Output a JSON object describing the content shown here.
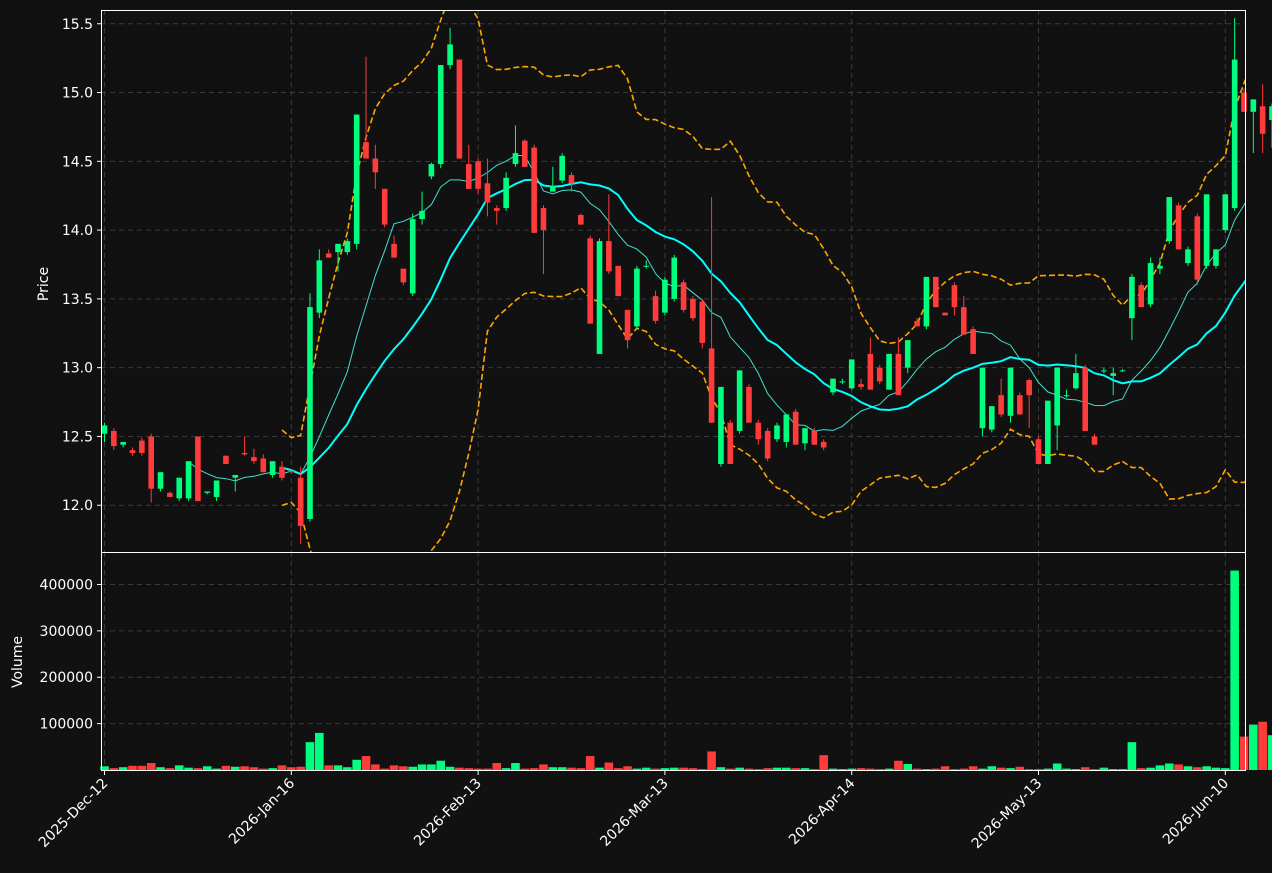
{
  "colors": {
    "background": "#111111",
    "up": "#00ff7f",
    "down": "#ff3b3b",
    "bollinger": "#ffa500",
    "ma_fast": "#40e0d0",
    "ma_slow": "#00ffff",
    "grid": "#3a3a3a",
    "axis": "#ffffff"
  },
  "chart_data": {
    "type": "candlestick",
    "panels": [
      "price",
      "volume"
    ],
    "title": "",
    "price_ylabel": "Price",
    "volume_ylabel": "Volume",
    "price_ylim": [
      11.66,
      15.6
    ],
    "price_yticks": [
      12.0,
      12.5,
      13.0,
      13.5,
      14.0,
      14.5,
      15.0,
      15.5
    ],
    "volume_ylim": [
      0,
      470000
    ],
    "volume_yticks": [
      100000,
      200000,
      300000,
      400000
    ],
    "x_tick_labels": [
      "2025-Dec-12",
      "2026-Jan-16",
      "2026-Feb-13",
      "2026-Mar-13",
      "2026-Apr-14",
      "2026-May-13",
      "2026-Jun-10"
    ],
    "x_tick_indices": [
      0,
      20,
      40,
      60,
      80,
      100,
      120
    ],
    "grid": true,
    "candles": [
      [
        12.52,
        12.6,
        12.46,
        12.58
      ],
      [
        12.54,
        12.56,
        12.4,
        12.43
      ],
      [
        12.44,
        12.46,
        12.42,
        12.46
      ],
      [
        12.4,
        12.42,
        12.36,
        12.38
      ],
      [
        12.47,
        12.49,
        12.36,
        12.38
      ],
      [
        12.5,
        12.52,
        12.02,
        12.12
      ],
      [
        12.12,
        12.24,
        12.1,
        12.24
      ],
      [
        12.09,
        12.1,
        12.06,
        12.06
      ],
      [
        12.05,
        12.2,
        12.03,
        12.2
      ],
      [
        12.05,
        12.32,
        12.03,
        12.32
      ],
      [
        12.5,
        12.5,
        12.03,
        12.03
      ],
      [
        12.09,
        12.1,
        12.08,
        12.1
      ],
      [
        12.06,
        12.18,
        12.03,
        12.18
      ],
      [
        12.36,
        12.36,
        12.3,
        12.3
      ],
      [
        12.2,
        12.22,
        12.1,
        12.22
      ],
      [
        12.38,
        12.5,
        12.36,
        12.37
      ],
      [
        12.35,
        12.41,
        12.3,
        12.32
      ],
      [
        12.34,
        12.37,
        12.24,
        12.24
      ],
      [
        12.22,
        12.32,
        12.2,
        12.32
      ],
      [
        12.28,
        12.32,
        12.18,
        12.2
      ],
      [
        12.25,
        12.26,
        12.23,
        12.24
      ],
      [
        12.2,
        12.28,
        11.72,
        11.85
      ],
      [
        11.9,
        13.54,
        11.88,
        13.44
      ],
      [
        13.4,
        13.86,
        13.36,
        13.78
      ],
      [
        13.83,
        13.86,
        13.8,
        13.8
      ],
      [
        13.84,
        13.9,
        13.7,
        13.9
      ],
      [
        13.84,
        13.94,
        13.82,
        13.92
      ],
      [
        13.9,
        14.84,
        13.86,
        14.84
      ],
      [
        14.64,
        15.26,
        14.52,
        14.52
      ],
      [
        14.52,
        14.62,
        14.3,
        14.42
      ],
      [
        14.3,
        14.3,
        14.02,
        14.04
      ],
      [
        13.9,
        13.96,
        13.8,
        13.8
      ],
      [
        13.72,
        13.72,
        13.6,
        13.62
      ],
      [
        13.54,
        14.12,
        13.52,
        14.08
      ],
      [
        14.08,
        14.28,
        14.04,
        14.14
      ],
      [
        14.39,
        14.49,
        14.37,
        14.48
      ],
      [
        14.48,
        15.2,
        14.45,
        15.2
      ],
      [
        15.2,
        15.47,
        15.17,
        15.35
      ],
      [
        15.24,
        15.24,
        14.52,
        14.52
      ],
      [
        14.48,
        14.62,
        14.3,
        14.3
      ],
      [
        14.5,
        14.52,
        14.26,
        14.3
      ],
      [
        14.34,
        14.52,
        14.1,
        14.2
      ],
      [
        14.16,
        14.18,
        14.04,
        14.14
      ],
      [
        14.16,
        14.42,
        14.14,
        14.38
      ],
      [
        14.48,
        14.76,
        14.46,
        14.56
      ],
      [
        14.65,
        14.66,
        14.46,
        14.46
      ],
      [
        14.6,
        14.62,
        13.98,
        13.98
      ],
      [
        14.16,
        14.18,
        13.68,
        14.0
      ],
      [
        14.28,
        14.46,
        14.28,
        14.32
      ],
      [
        14.36,
        14.56,
        14.34,
        14.54
      ],
      [
        14.4,
        14.42,
        14.28,
        14.34
      ],
      [
        14.11,
        14.12,
        14.04,
        14.04
      ],
      [
        13.94,
        13.96,
        13.32,
        13.32
      ],
      [
        13.1,
        13.94,
        13.1,
        13.92
      ],
      [
        13.92,
        14.26,
        13.68,
        13.7
      ],
      [
        13.74,
        13.74,
        13.52,
        13.52
      ],
      [
        13.42,
        13.42,
        13.14,
        13.2
      ],
      [
        13.3,
        13.74,
        13.28,
        13.72
      ],
      [
        13.74,
        13.78,
        13.72,
        13.74
      ],
      [
        13.52,
        13.56,
        13.32,
        13.34
      ],
      [
        13.4,
        13.66,
        13.38,
        13.64
      ],
      [
        13.5,
        13.82,
        13.48,
        13.8
      ],
      [
        13.62,
        13.64,
        13.4,
        13.42
      ],
      [
        13.5,
        13.52,
        13.34,
        13.36
      ],
      [
        13.48,
        13.5,
        13.14,
        13.18
      ],
      [
        13.14,
        14.24,
        12.6,
        12.6
      ],
      [
        12.3,
        12.86,
        12.28,
        12.86
      ],
      [
        12.6,
        12.62,
        12.3,
        12.3
      ],
      [
        12.54,
        12.98,
        12.52,
        12.98
      ],
      [
        12.86,
        12.88,
        12.62,
        12.6
      ],
      [
        12.6,
        12.62,
        12.44,
        12.48
      ],
      [
        12.54,
        12.56,
        12.32,
        12.34
      ],
      [
        12.48,
        12.6,
        12.46,
        12.58
      ],
      [
        12.46,
        12.66,
        12.42,
        12.66
      ],
      [
        12.68,
        12.7,
        12.44,
        12.44
      ],
      [
        12.45,
        12.56,
        12.4,
        12.56
      ],
      [
        12.54,
        12.56,
        12.44,
        12.44
      ],
      [
        12.46,
        12.48,
        12.4,
        12.42
      ],
      [
        12.82,
        12.92,
        12.8,
        12.92
      ],
      [
        12.9,
        12.92,
        12.88,
        12.9
      ],
      [
        12.85,
        13.06,
        12.84,
        13.06
      ],
      [
        12.88,
        12.92,
        12.84,
        12.86
      ],
      [
        13.1,
        13.22,
        12.84,
        12.84
      ],
      [
        13.0,
        13.02,
        12.88,
        12.9
      ],
      [
        12.84,
        13.1,
        12.84,
        13.1
      ],
      [
        13.1,
        13.22,
        12.8,
        12.8
      ],
      [
        13.0,
        13.2,
        12.96,
        13.2
      ],
      [
        13.34,
        13.36,
        13.3,
        13.3
      ],
      [
        13.3,
        13.66,
        13.28,
        13.66
      ],
      [
        13.66,
        13.66,
        13.44,
        13.44
      ],
      [
        13.4,
        13.4,
        13.38,
        13.38
      ],
      [
        13.6,
        13.62,
        13.38,
        13.44
      ],
      [
        13.44,
        13.52,
        13.24,
        13.24
      ],
      [
        13.28,
        13.3,
        13.1,
        13.1
      ],
      [
        12.56,
        13.0,
        12.5,
        13.0
      ],
      [
        12.55,
        12.72,
        12.53,
        12.72
      ],
      [
        12.8,
        12.92,
        12.64,
        12.66
      ],
      [
        12.65,
        13.0,
        12.6,
        13.0
      ],
      [
        12.8,
        12.82,
        12.66,
        12.66
      ],
      [
        12.91,
        12.92,
        12.56,
        12.8
      ],
      [
        12.48,
        12.5,
        12.3,
        12.3
      ],
      [
        12.3,
        12.76,
        12.3,
        12.76
      ],
      [
        12.58,
        13.0,
        12.4,
        13.0
      ],
      [
        12.8,
        12.84,
        12.78,
        12.8
      ],
      [
        12.85,
        13.1,
        12.84,
        12.96
      ],
      [
        13.0,
        13.02,
        12.54,
        12.54
      ],
      [
        12.5,
        12.52,
        12.44,
        12.44
      ],
      [
        12.98,
        13.0,
        12.96,
        12.98
      ],
      [
        12.94,
        13.0,
        12.8,
        12.96
      ],
      [
        12.98,
        12.99,
        12.97,
        12.98
      ],
      [
        13.36,
        13.68,
        13.2,
        13.66
      ],
      [
        13.6,
        13.62,
        13.44,
        13.44
      ],
      [
        13.46,
        13.8,
        13.44,
        13.76
      ],
      [
        13.72,
        13.8,
        13.68,
        13.74
      ],
      [
        13.92,
        14.24,
        13.9,
        14.24
      ],
      [
        14.18,
        14.2,
        13.88,
        13.86
      ],
      [
        13.76,
        13.88,
        13.74,
        13.86
      ],
      [
        14.1,
        14.12,
        13.6,
        13.64
      ],
      [
        13.74,
        14.26,
        13.72,
        14.26
      ],
      [
        13.74,
        13.86,
        13.72,
        13.86
      ],
      [
        14.0,
        14.26,
        13.98,
        14.26
      ],
      [
        14.16,
        15.54,
        14.14,
        15.24
      ],
      [
        15.0,
        15.03,
        14.86,
        14.86
      ],
      [
        14.86,
        14.95,
        14.56,
        14.95
      ],
      [
        14.9,
        15.06,
        14.56,
        14.7
      ],
      [
        14.8,
        14.92,
        14.6,
        14.9
      ],
      [
        14.96,
        15.04,
        14.92,
        14.94
      ]
    ],
    "volume": [
      8000,
      4000,
      6000,
      9000,
      9000,
      15000,
      6000,
      4000,
      10000,
      5000,
      4000,
      8000,
      3000,
      9000,
      7000,
      8000,
      6000,
      3000,
      4000,
      10000,
      6000,
      7000,
      60000,
      80000,
      10000,
      10000,
      6000,
      22000,
      30000,
      12000,
      3000,
      10000,
      8000,
      7000,
      12000,
      12000,
      20000,
      7000,
      5000,
      4000,
      3000,
      3000,
      15000,
      4000,
      15000,
      3000,
      4000,
      12000,
      6000,
      6000,
      5000,
      4000,
      30000,
      5000,
      16000,
      4000,
      8000,
      3000,
      5000,
      3000,
      4000,
      5000,
      5000,
      4000,
      2000,
      40000,
      6000,
      3000,
      5000,
      3000,
      2000,
      4000,
      5000,
      5000,
      4000,
      4000,
      2000,
      32000,
      3000,
      2000,
      3000,
      4000,
      3000,
      2000,
      3000,
      20000,
      13000,
      3000,
      2000,
      3000,
      8000,
      2000,
      3000,
      8000,
      3000,
      8000,
      5000,
      4000,
      7000,
      2000,
      2000,
      3000,
      14000,
      3000,
      2000,
      6000,
      2000,
      5000,
      2000,
      2000,
      60000,
      4000,
      5000,
      10000,
      14000,
      12000,
      8000,
      6000,
      8000,
      5000,
      4000,
      430000,
      72000,
      98000,
      104000,
      75000,
      82000
    ],
    "bollinger_upper_range": [
      19,
      125
    ],
    "ma_fast_range": [
      9,
      125
    ],
    "ma_slow_range": [
      19,
      125
    ]
  }
}
